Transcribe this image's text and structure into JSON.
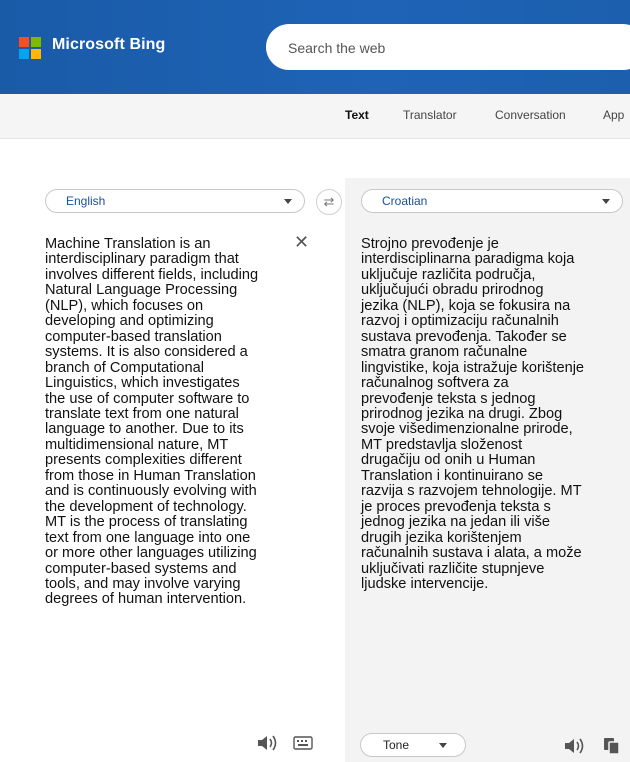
{
  "header": {
    "brand": "Microsoft Bing",
    "search_placeholder": "Search the web"
  },
  "nav": {
    "items": [
      "Text",
      "Translator",
      "Conversation",
      "App"
    ],
    "active": "Text"
  },
  "translator": {
    "source_language": "English",
    "target_language": "Croatian",
    "tone_label": "Tone",
    "source_text": "Machine Translation is an\ninterdisciplinary paradigm that\ninvolves different fields, including\nNatural Language Processing\n(NLP), which focuses on\ndeveloping and optimizing\ncomputer-based translation\nsystems. It is also considered a\nbranch of Computational\nLinguistics, which investigates\nthe use of computer software to\ntranslate text from one natural\nlanguage to another. Due to its\nmultidimensional nature, MT\npresents complexities different\nfrom those in Human Translation\nand is continuously evolving with\nthe development of technology.\nMT is the process of translating\ntext from one language into one\nor more other languages utilizing\ncomputer-based systems and\ntools, and may involve varying\ndegrees of human intervention.",
    "target_text": "Strojno prevođenje je\ninterdisciplinarna paradigma koja\nuključuje različita područja,\nuključujući obradu prirodnog\njezika (NLP), koja se fokusira na\nrazvoj i optimizaciju računalnih\nsustava prevođenja. Također se\nsmatra granom računalne\nlingvistike, koja istražuje korištenje\nračunalnog softvera za\nprevođenje teksta s jednog\nprirodnog jezika na drugi. Zbog\nsvoje višedimenzionalne prirode,\nMT predstavlja složenost\ndrugačiju od onih u Human\nTranslation i kontinuirano se\nrazvija s razvojem tehnologije. MT\nje proces prevođenja teksta s\njednog jezika na jedan ili više\ndrugih jezika korištenjem\nračunalnih sustava i alata, a može\nuključivati različite stupnjeve\nljudske intervencije."
  },
  "icons": {
    "brand_logo": "windows-logo-icon",
    "swap": "swap-arrows-icon",
    "clear": "close-icon",
    "speaker": "speaker-icon",
    "keyboard": "keyboard-icon",
    "copy": "copy-icon",
    "dropdown": "chevron-down-icon"
  },
  "colors": {
    "header_bg": "#1b5fae",
    "language_text": "#1a4fa0"
  }
}
